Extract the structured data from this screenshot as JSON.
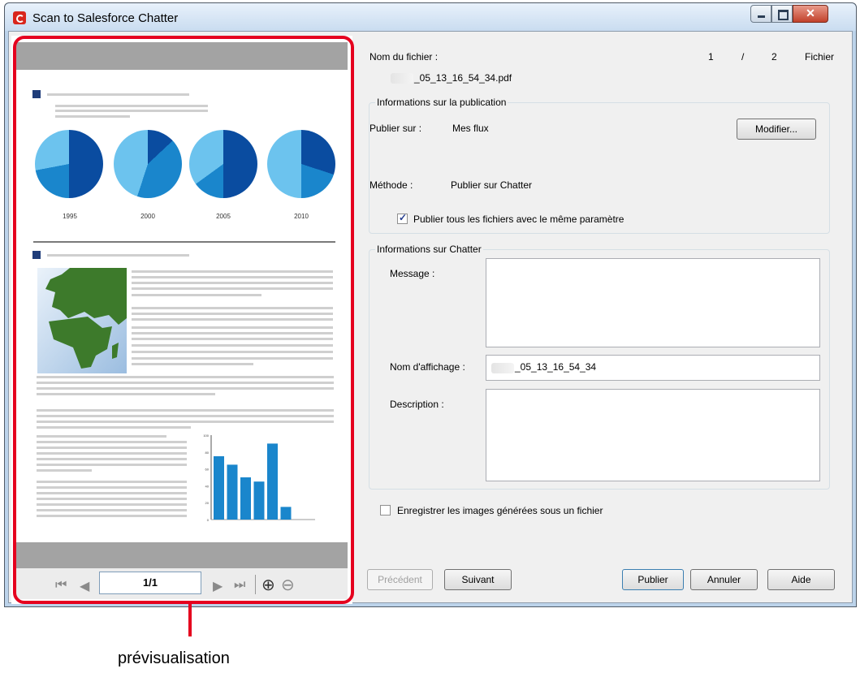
{
  "window": {
    "title": "Scan to Salesforce Chatter"
  },
  "preview": {
    "chart_years": [
      "1995",
      "2000",
      "2005",
      "2010"
    ],
    "bar_axis_ticks": [
      "100",
      "80",
      "60",
      "40",
      "20",
      "0"
    ],
    "bar_values": [
      75,
      65,
      50,
      45,
      90,
      15
    ],
    "page_indicator": "1/1"
  },
  "file": {
    "name_label": "Nom du fichier :",
    "filename": "_05_13_16_54_34.pdf",
    "current": "1",
    "separator": "/",
    "total": "2",
    "unit": "Fichier"
  },
  "publication": {
    "group_title": "Informations sur la publication",
    "publish_on_label": "Publier sur :",
    "publish_on_value": "Mes flux",
    "modify_button": "Modifier...",
    "method_label": "Méthode :",
    "method_value": "Publier sur Chatter",
    "same_setting_checkbox": "Publier tous les fichiers avec le même paramètre",
    "same_setting_checked": true
  },
  "chatter": {
    "group_title": "Informations sur Chatter",
    "message_label": "Message :",
    "message_value": "",
    "display_name_label": "Nom d'affichage :",
    "display_name_value": "_05_13_16_54_34",
    "description_label": "Description :",
    "description_value": ""
  },
  "save_images": {
    "label": "Enregistrer les images générées sous un fichier",
    "checked": false
  },
  "buttons": {
    "previous": "Précédent",
    "next": "Suivant",
    "publish": "Publier",
    "cancel": "Annuler",
    "help": "Aide"
  },
  "caption": "prévisualisation",
  "colors": {
    "highlight": "#e5001e",
    "pie_dark": "#0a4ca0",
    "pie_mid": "#1a86cc",
    "pie_light": "#6cc3ee",
    "bars": "#1a86cc",
    "map_land": "#3d7a2b"
  }
}
